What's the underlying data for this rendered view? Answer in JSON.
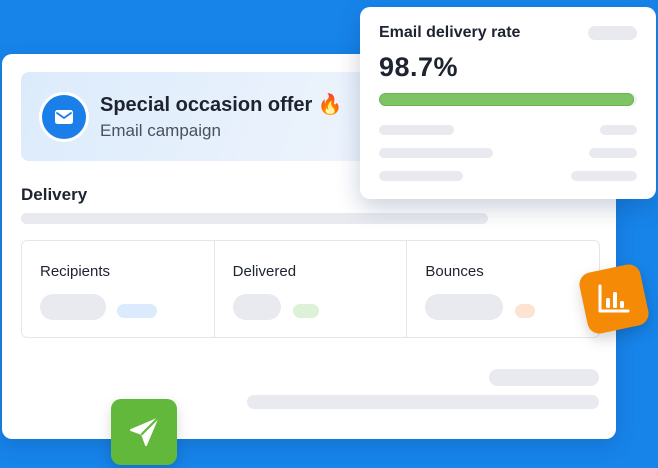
{
  "campaign": {
    "title": "Special occasion offer",
    "emoji": "🔥",
    "subtitle": "Email campaign",
    "icon": "mail-icon"
  },
  "delivery": {
    "heading": "Delivery",
    "stats": [
      {
        "label": "Recipients",
        "accent": "#dbeafc"
      },
      {
        "label": "Delivered",
        "accent": "#dcf1d8"
      },
      {
        "label": "Bounces",
        "accent": "#fde3d2"
      }
    ]
  },
  "rate_card": {
    "title": "Email delivery rate",
    "value": "98.7%",
    "progress_fraction": 0.987
  },
  "badges": {
    "chart_icon": "bar-chart-icon",
    "send_icon": "send-icon"
  },
  "colors": {
    "background": "#1784ea",
    "brand_blue": "#1a7fe8",
    "progress_green": "#7ec465",
    "chart_orange": "#f58a07",
    "send_green": "#62b83a"
  }
}
